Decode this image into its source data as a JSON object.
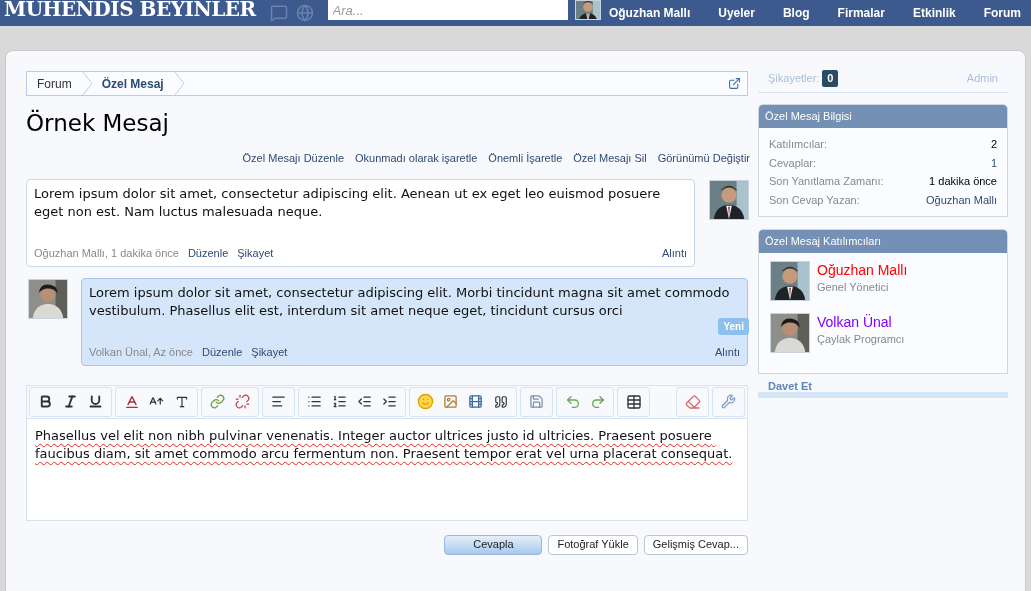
{
  "header": {
    "logo": "MUHENDIS BEYINLER",
    "search": {
      "placeholder": "Ara..."
    },
    "user": "Oğuzhan Mallı",
    "nav": [
      "Uyeler",
      "Blog",
      "Firmalar",
      "Etkinlik",
      "Forum"
    ]
  },
  "breadcrumb": [
    "Forum",
    "Özel Mesaj"
  ],
  "title": "Örnek Mesaj",
  "actions": [
    "Özel Mesajı Düzenle",
    "Okunmadı olarak işaretle",
    "Önemli İşaretle",
    "Özel Mesajı Sil",
    "Görünümü Değiştir"
  ],
  "messages": [
    {
      "text": "Lorem ipsum dolor sit amet, consectetur adipiscing elit. Aenean ut ex eget leo euismod posuere eget non est. Nam luctus malesuada neque.",
      "meta": "Oğuzhan Mallı, 1 dakika önce",
      "links": [
        "Düzenle",
        "Şikayet"
      ],
      "quote": "Alıntı",
      "kind": "own",
      "is_new": false
    },
    {
      "text": "Lorem ipsum dolor sit amet, consectetur adipiscing elit. Morbi tincidunt magna sit amet commodo vestibulum. Phasellus elit est, interdum sit amet neque eget, tincidunt cursus orci",
      "meta": "Volkan Ünal, Az önce",
      "links": [
        "Düzenle",
        "Şikayet"
      ],
      "quote": "Alıntı",
      "kind": "other",
      "is_new": true,
      "badge": "Yeni"
    }
  ],
  "editor": {
    "value": "Phasellus vel elit non nibh pulvinar venenatis. Integer auctor ultrices justo id ultricies. Praesent posuere faucibus diam, sit amet commodo arcu fermentum non. Praesent tempor erat vel urna placerat consequat."
  },
  "buttons": [
    {
      "label": "Cevapla",
      "primary": true
    },
    {
      "label": "Fotoğraf Yükle",
      "primary": false
    },
    {
      "label": "Gelişmiş Cevap...",
      "primary": false
    }
  ],
  "sidebar": {
    "reports": {
      "label": "Şikayetler:",
      "count": "0"
    },
    "admin": "Admin",
    "info": {
      "title": "Özel Mesaj Bilgisi",
      "rows": [
        {
          "label": "Katılımcılar:",
          "value": "2",
          "link": false
        },
        {
          "label": "Cevaplar:",
          "value": "1",
          "link": true
        },
        {
          "label": "Son Yanıtlama Zamanı:",
          "value": "1 dakika önce",
          "link": false
        },
        {
          "label": "Son Cevap Yazan:",
          "value": "Oğuzhan Mallı",
          "link": true
        }
      ]
    },
    "participants": {
      "title": "Özel Mesaj Katılımcıları",
      "items": [
        {
          "name": "Oğuzhan Mallı",
          "role": "Genel Yönetici",
          "color": "#ff0000"
        },
        {
          "name": "Volkan Ünal",
          "role": "Çaylak Programcı",
          "color": "#7f00ff"
        }
      ]
    },
    "invite": "Davet Et"
  }
}
